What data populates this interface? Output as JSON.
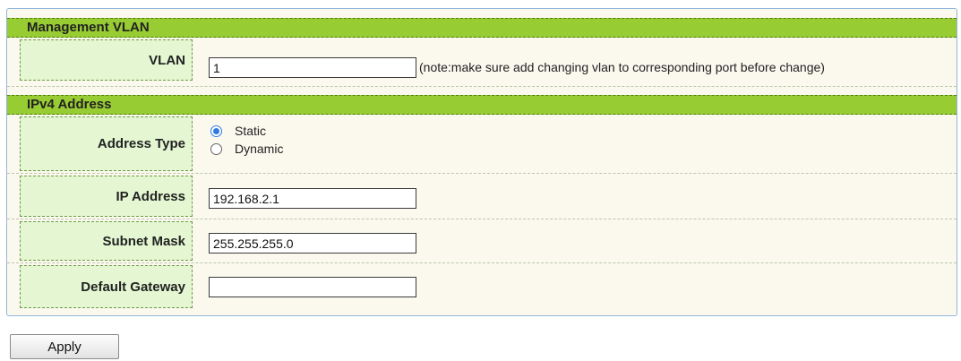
{
  "management_vlan": {
    "header": "Management VLAN",
    "vlan_label": "VLAN",
    "vlan_value": "1",
    "note": "(note:make sure add changing vlan to corresponding port before change)"
  },
  "ipv4": {
    "header": "IPv4 Address",
    "address_type_label": "Address Type",
    "address_type_options": [
      {
        "label": "Static",
        "selected": true
      },
      {
        "label": "Dynamic",
        "selected": false
      }
    ],
    "ip_address_label": "IP Address",
    "ip_address_value": "192.168.2.1",
    "subnet_mask_label": "Subnet Mask",
    "subnet_mask_value": "255.255.255.0",
    "default_gateway_label": "Default Gateway",
    "default_gateway_value": ""
  },
  "apply_label": "Apply",
  "colors": {
    "header_green": "#98cc33",
    "label_cell_bg": "#e4f7d2",
    "panel_bg": "#fbf8ee",
    "radio_accent": "#2f7be0"
  }
}
